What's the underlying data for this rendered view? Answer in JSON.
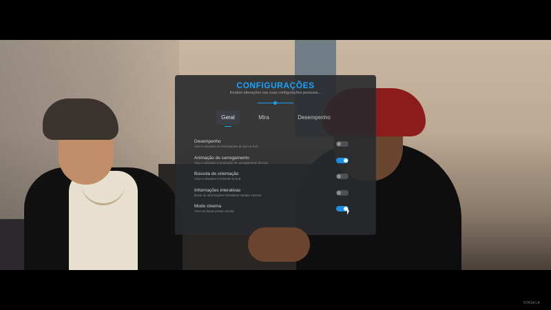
{
  "settings_panel": {
    "title": "CONFIGURAÇÕES",
    "subtitle": "Realize alterações nas suas configurações pessoais...",
    "accent_color": "#1aa3ff",
    "tabs": [
      {
        "label": "Geral",
        "active": true
      },
      {
        "label": "Mira",
        "active": false
      },
      {
        "label": "Desempenho",
        "active": false
      }
    ],
    "options": [
      {
        "title": "Desempenho",
        "description": "Ative e desative as informações de fps na hud.",
        "enabled": false
      },
      {
        "title": "Animação de carregamento",
        "description": "Ative e desative a animação de carregamento da hud.",
        "enabled": true
      },
      {
        "title": "Bússola de orientação",
        "description": "Ative e desative a bússola na hud.",
        "enabled": false
      },
      {
        "title": "Informações interativas",
        "description": "Deixe as informações interativas sempre visíveis.",
        "enabled": false
      },
      {
        "title": "Modo cinema",
        "description": "Ative as faixas pretas na tela.",
        "enabled": true
      }
    ]
  },
  "watermark": "NTASA LA"
}
